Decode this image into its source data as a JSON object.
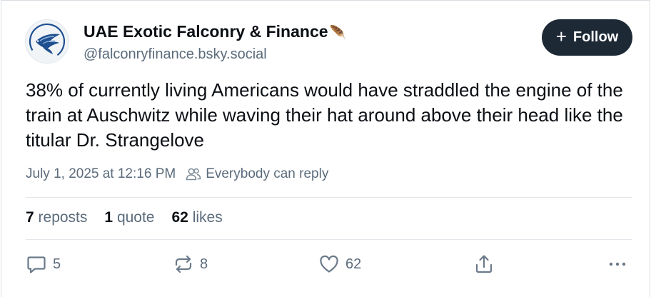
{
  "author": {
    "display_name": "UAE Exotic Falconry & Finance",
    "name_emoji": "🪶",
    "handle": "@falconryfinance.bsky.social",
    "avatar_icon": "falcon-logo-icon"
  },
  "follow": {
    "label": "Follow",
    "plus": "+"
  },
  "post": {
    "text": "38% of currently living Americans would have straddled the engine of the train at Auschwitz while waving their hat around above their head like the titular Dr. Strangelove",
    "timestamp": "July 1, 2025 at 12:16 PM",
    "reply_setting": "Everybody can reply"
  },
  "stats": {
    "reposts_count": "7",
    "reposts_label": "reposts",
    "quotes_count": "1",
    "quotes_label": "quote",
    "likes_count": "62",
    "likes_label": "likes"
  },
  "actions": {
    "reply_count": "5",
    "repost_count": "8",
    "like_count": "62",
    "icons": [
      "reply-icon",
      "repost-icon",
      "like-icon",
      "share-icon",
      "more-icon"
    ]
  },
  "colors": {
    "text_primary": "#0b0f14",
    "text_secondary": "#5b6b7c",
    "follow_bg": "#1e2936",
    "divider": "#e3e7eb",
    "avatar_blue": "#1f4f8f"
  }
}
